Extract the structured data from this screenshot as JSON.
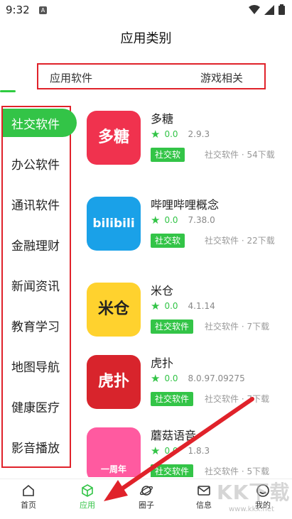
{
  "status": {
    "time": "9:32",
    "notif": "A"
  },
  "title": "应用类别",
  "tabs": [
    {
      "label": "应用软件"
    },
    {
      "label": "游戏相关"
    }
  ],
  "categories": [
    {
      "label": "社交软件"
    },
    {
      "label": "办公软件"
    },
    {
      "label": "通讯软件"
    },
    {
      "label": "金融理财"
    },
    {
      "label": "新闻资讯"
    },
    {
      "label": "教育学习"
    },
    {
      "label": "地图导航"
    },
    {
      "label": "健康医疗"
    },
    {
      "label": "影音播放"
    }
  ],
  "apps": [
    {
      "name": "多糖",
      "score": "0.0",
      "version": "2.9.3",
      "tag": "社交软",
      "meta": "社交软件 · 54下载",
      "icon_text": "多糖",
      "color": "#f0324e"
    },
    {
      "name": "哔哩哔哩概念",
      "score": "0.0",
      "version": "7.38.0",
      "tag": "社交软",
      "meta": "社交软件 · 22下载",
      "icon_text": "bilibili",
      "color": "#1aa1e8"
    },
    {
      "name": "米仓",
      "score": "0.0",
      "version": "4.1.14",
      "tag": "社交软件",
      "meta": "社交软件 · 7下载",
      "icon_text": "米仓",
      "color": "#ffd22e"
    },
    {
      "name": "虎扑",
      "score": "0.0",
      "version": "8.0.97.09275",
      "tag": "社交软件",
      "meta": "社交软件 · 7下载",
      "icon_text": "虎扑",
      "color": "#d8242c"
    },
    {
      "name": "蘑菇语音",
      "score": "0.0",
      "version": "1.8.3",
      "tag": "社交软件",
      "meta": "社交软件 · 5下载",
      "icon_text": "一周年",
      "color": "#ff5aa0"
    }
  ],
  "nav": [
    {
      "label": "首页"
    },
    {
      "label": "应用"
    },
    {
      "label": "圈子"
    },
    {
      "label": "信息"
    },
    {
      "label": "我的"
    }
  ],
  "watermark": {
    "text": "KK下载",
    "url": "www.kkx.net"
  },
  "colors": {
    "accent": "#33c447",
    "highlight": "#e0222a"
  }
}
